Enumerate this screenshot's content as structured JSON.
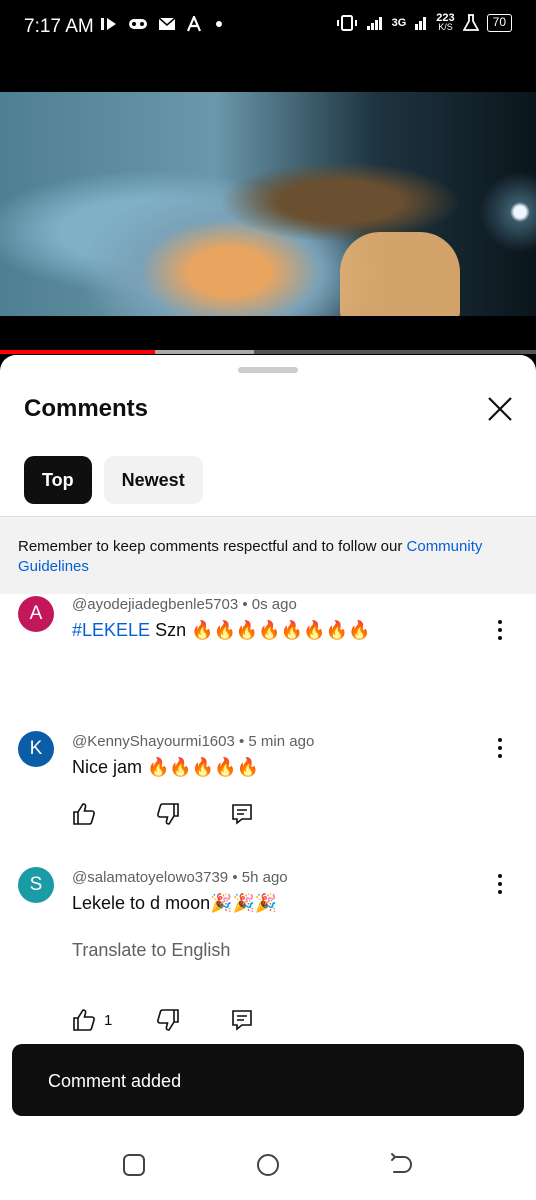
{
  "status_bar": {
    "time": "7:17 AM",
    "network": "3G",
    "speed_value": "223",
    "speed_unit": "K/S",
    "battery": "70",
    "icons": [
      "youtube-play-icon",
      "gamepad-icon",
      "mail-icon",
      "font-icon",
      "dot-icon",
      "vibrate-icon",
      "signal-icon",
      "signal-3g-icon",
      "lab-icon",
      "battery-icon"
    ]
  },
  "video": {
    "progress_played": 0.29
  },
  "sheet": {
    "title": "Comments",
    "tabs": [
      {
        "label": "Top",
        "active": true
      },
      {
        "label": "Newest",
        "active": false
      }
    ],
    "notice_text": "Remember to keep comments respectful and to follow our ",
    "notice_link": "Community Guidelines"
  },
  "comments": [
    {
      "initial": "A",
      "avatar_color": "#c2185b",
      "author": "@ayodejiadegbenle5703",
      "time": "0s ago",
      "hashtag": "#LEKELE",
      "text": " Szn 🔥🔥🔥🔥🔥🔥🔥🔥"
    },
    {
      "initial": "K",
      "avatar_color": "#0b5da8",
      "author": "@KennyShayourmi1603",
      "time": "5 min ago",
      "text": "Nice jam 🔥🔥🔥🔥🔥"
    },
    {
      "initial": "S",
      "avatar_color": "#1a9ba6",
      "author": "@salamatoyelowo3739",
      "time": "5h ago",
      "text": "Lekele to d moon🎉🎉🎉",
      "translate": "Translate to English",
      "likes": "1"
    }
  ],
  "separator": " • ",
  "toast": "Comment added",
  "colors": {
    "progress": "#ff0000",
    "link": "#065fd4",
    "chip_active": "#0f0f0f"
  }
}
